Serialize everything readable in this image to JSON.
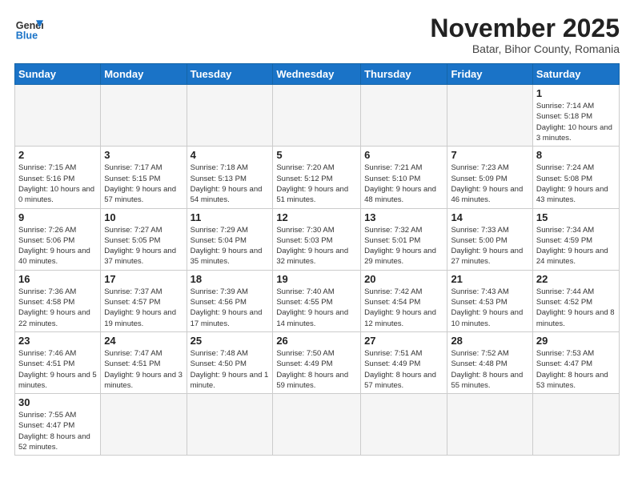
{
  "logo": {
    "line1": "General",
    "line2": "Blue"
  },
  "title": {
    "month_year": "November 2025",
    "location": "Batar, Bihor County, Romania"
  },
  "weekdays": [
    "Sunday",
    "Monday",
    "Tuesday",
    "Wednesday",
    "Thursday",
    "Friday",
    "Saturday"
  ],
  "weeks": [
    [
      {
        "day": "",
        "info": ""
      },
      {
        "day": "",
        "info": ""
      },
      {
        "day": "",
        "info": ""
      },
      {
        "day": "",
        "info": ""
      },
      {
        "day": "",
        "info": ""
      },
      {
        "day": "",
        "info": ""
      },
      {
        "day": "1",
        "info": "Sunrise: 7:14 AM\nSunset: 5:18 PM\nDaylight: 10 hours\nand 3 minutes."
      }
    ],
    [
      {
        "day": "2",
        "info": "Sunrise: 7:15 AM\nSunset: 5:16 PM\nDaylight: 10 hours\nand 0 minutes."
      },
      {
        "day": "3",
        "info": "Sunrise: 7:17 AM\nSunset: 5:15 PM\nDaylight: 9 hours\nand 57 minutes."
      },
      {
        "day": "4",
        "info": "Sunrise: 7:18 AM\nSunset: 5:13 PM\nDaylight: 9 hours\nand 54 minutes."
      },
      {
        "day": "5",
        "info": "Sunrise: 7:20 AM\nSunset: 5:12 PM\nDaylight: 9 hours\nand 51 minutes."
      },
      {
        "day": "6",
        "info": "Sunrise: 7:21 AM\nSunset: 5:10 PM\nDaylight: 9 hours\nand 48 minutes."
      },
      {
        "day": "7",
        "info": "Sunrise: 7:23 AM\nSunset: 5:09 PM\nDaylight: 9 hours\nand 46 minutes."
      },
      {
        "day": "8",
        "info": "Sunrise: 7:24 AM\nSunset: 5:08 PM\nDaylight: 9 hours\nand 43 minutes."
      }
    ],
    [
      {
        "day": "9",
        "info": "Sunrise: 7:26 AM\nSunset: 5:06 PM\nDaylight: 9 hours\nand 40 minutes."
      },
      {
        "day": "10",
        "info": "Sunrise: 7:27 AM\nSunset: 5:05 PM\nDaylight: 9 hours\nand 37 minutes."
      },
      {
        "day": "11",
        "info": "Sunrise: 7:29 AM\nSunset: 5:04 PM\nDaylight: 9 hours\nand 35 minutes."
      },
      {
        "day": "12",
        "info": "Sunrise: 7:30 AM\nSunset: 5:03 PM\nDaylight: 9 hours\nand 32 minutes."
      },
      {
        "day": "13",
        "info": "Sunrise: 7:32 AM\nSunset: 5:01 PM\nDaylight: 9 hours\nand 29 minutes."
      },
      {
        "day": "14",
        "info": "Sunrise: 7:33 AM\nSunset: 5:00 PM\nDaylight: 9 hours\nand 27 minutes."
      },
      {
        "day": "15",
        "info": "Sunrise: 7:34 AM\nSunset: 4:59 PM\nDaylight: 9 hours\nand 24 minutes."
      }
    ],
    [
      {
        "day": "16",
        "info": "Sunrise: 7:36 AM\nSunset: 4:58 PM\nDaylight: 9 hours\nand 22 minutes."
      },
      {
        "day": "17",
        "info": "Sunrise: 7:37 AM\nSunset: 4:57 PM\nDaylight: 9 hours\nand 19 minutes."
      },
      {
        "day": "18",
        "info": "Sunrise: 7:39 AM\nSunset: 4:56 PM\nDaylight: 9 hours\nand 17 minutes."
      },
      {
        "day": "19",
        "info": "Sunrise: 7:40 AM\nSunset: 4:55 PM\nDaylight: 9 hours\nand 14 minutes."
      },
      {
        "day": "20",
        "info": "Sunrise: 7:42 AM\nSunset: 4:54 PM\nDaylight: 9 hours\nand 12 minutes."
      },
      {
        "day": "21",
        "info": "Sunrise: 7:43 AM\nSunset: 4:53 PM\nDaylight: 9 hours\nand 10 minutes."
      },
      {
        "day": "22",
        "info": "Sunrise: 7:44 AM\nSunset: 4:52 PM\nDaylight: 9 hours\nand 8 minutes."
      }
    ],
    [
      {
        "day": "23",
        "info": "Sunrise: 7:46 AM\nSunset: 4:51 PM\nDaylight: 9 hours\nand 5 minutes."
      },
      {
        "day": "24",
        "info": "Sunrise: 7:47 AM\nSunset: 4:51 PM\nDaylight: 9 hours\nand 3 minutes."
      },
      {
        "day": "25",
        "info": "Sunrise: 7:48 AM\nSunset: 4:50 PM\nDaylight: 9 hours\nand 1 minute."
      },
      {
        "day": "26",
        "info": "Sunrise: 7:50 AM\nSunset: 4:49 PM\nDaylight: 8 hours\nand 59 minutes."
      },
      {
        "day": "27",
        "info": "Sunrise: 7:51 AM\nSunset: 4:49 PM\nDaylight: 8 hours\nand 57 minutes."
      },
      {
        "day": "28",
        "info": "Sunrise: 7:52 AM\nSunset: 4:48 PM\nDaylight: 8 hours\nand 55 minutes."
      },
      {
        "day": "29",
        "info": "Sunrise: 7:53 AM\nSunset: 4:47 PM\nDaylight: 8 hours\nand 53 minutes."
      }
    ],
    [
      {
        "day": "30",
        "info": "Sunrise: 7:55 AM\nSunset: 4:47 PM\nDaylight: 8 hours\nand 52 minutes."
      },
      {
        "day": "",
        "info": ""
      },
      {
        "day": "",
        "info": ""
      },
      {
        "day": "",
        "info": ""
      },
      {
        "day": "",
        "info": ""
      },
      {
        "day": "",
        "info": ""
      },
      {
        "day": "",
        "info": ""
      }
    ]
  ]
}
